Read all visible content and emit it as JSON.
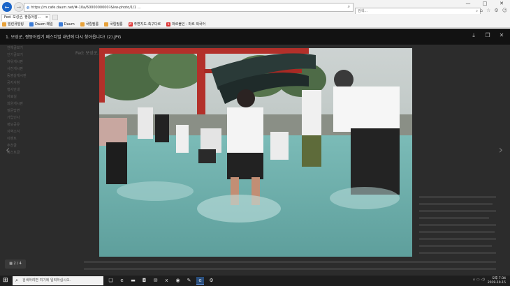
{
  "browser": {
    "url": "https://m.cafe.daum.net/#-10a/6000000000?&kw-photo/1/1 ...",
    "search_placeholder": "검색...",
    "tab_title": "Fed: 보성군, 짱뚱어잡...",
    "favorites": [
      "밀린뮤빌링",
      "Daum 메일",
      "Daum",
      "국립필름",
      "국립필름",
      "주변지도-축구다르",
      "마르볼인 - 마르 외국어"
    ]
  },
  "viewer": {
    "title": "1. 보성군, 짱뚱어잡기 페스티벌 내년에 다시 찾아옵니다! (2).JPG",
    "counter": "2 / 4",
    "page_title": "Fed: 보성군, 짱뚱어잡기 페스티벌",
    "sidebar": [
      "전체글보기",
      "인기글보기",
      "자유게시판",
      "사진게시판",
      "동영상게시판",
      "공지사항",
      "행사안내",
      "자료실",
      "회원게시판",
      "질문답변",
      "가입인사",
      "정보공유",
      "지역소식",
      "이벤트",
      "추천글",
      "베스트글"
    ]
  },
  "taskbar": {
    "search_placeholder": "검색하려면 여기에 입력하십시오.",
    "time": "오후 7:34",
    "date": "2019-10-15"
  },
  "colors": {
    "viewer_bar": "#121212",
    "overlay": "#2c2c2c",
    "ie_blue": "#1a64c8",
    "water": "#6aa8a6"
  }
}
